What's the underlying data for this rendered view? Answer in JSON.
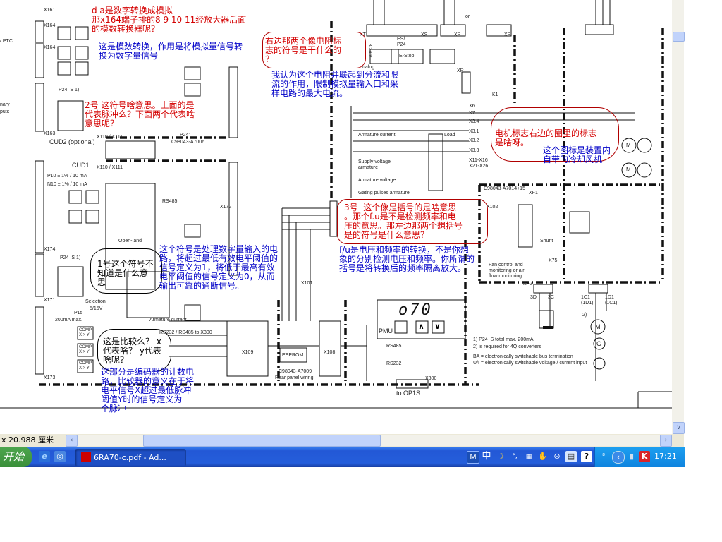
{
  "annotations": {
    "q_da": "d a是数字转换成模拟\n那x164端子排的8 9 10 11经放大器后面\n的模数转换器呢？",
    "a_ad": "这是模数转换，作用是将模拟量信号转\n换为数字量信号",
    "q2": "2号 这符号啥意思。上面的是\n代表脉冲么？下面两个代表啥\n意思呢？",
    "q_resistor": "右边那两个像电阻标\n志的符号是干什么的\n？",
    "a_resistor": "我认为这个电阻并联起到分流和限\n流的作用，限制模拟量输入口和采\n样电路的最大电流。",
    "q3": "3号  这个像是括号的是啥意思\n。那个f.u是不是检测频率和电\n压的意思。那左边那两个想括号\n是的符号是什么意思？",
    "a3": "f/u是电压和频率的转换，不是你想\n象的分别检测电压和频率。你所谓的\n括号是将转换后的频率隔离放大。",
    "q_motor": "电机标志右边的圈里的标志\n是啥呀。",
    "a_motor": "这个图标是装置内\n自带的冷却风机",
    "q1": "1号这个符号不\n知道是什么意\n思",
    "a1": "这个符号是处理数字量输入的电\n路，将超过最低有效电平阈值的\n信号定义为1，将低于最高有效\n电平阈值的信号定义为0，从而\n输出可靠的通断信号。",
    "q_comp": "这是比较么？ x\n代表啥？ y代表\n啥呢？",
    "a_comp": "这部分是编码器的计数电\n路，比较器的意义在于将\n电平信号X超过最低脉冲\n阈值Y时的信号定义为一\n个脉冲"
  },
  "schematic": {
    "x161": "X161",
    "x164a": "X164",
    "x164b": "X164",
    "x163": "X163",
    "ptc": "/ PTC",
    "p24s": "P24_S 1)",
    "binary": "nary",
    "inputs": "puts",
    "cud2": "CUD2 (optional)",
    "x110a": "X110 / X111",
    "x110b": "X110 / X111",
    "cud1": "CUD1",
    "p10": "P10  ± 1% / 10 mA",
    "n10": "N10  ± 1% / 10 mA",
    "c98043_7006": "C98043-A7006",
    "p24p": "P24'",
    "rs485a": "RS485",
    "x172": "X172",
    "x174": "X174",
    "x171": "X171",
    "x173": "X173",
    "openand": "Open- and",
    "selection": "Selection",
    "v515": "5/15V",
    "p15": "P15",
    "ma200": "200mA max.",
    "armcur": "Armature current",
    "rs232": "RS232 / RS485 to X300",
    "x109": "X109",
    "x108": "X108",
    "x101": "X101",
    "eeprom": "EEPROM",
    "c98043_7009": "C98043-A7009",
    "rearpanel": "Rear panel wiring",
    "pmu": "PMU",
    "display": "o70",
    "rs485b": "RS485",
    "rs232b": "RS232",
    "x300": "X300",
    "toop1s": "to  OP1S",
    "estop": "E-Stop",
    "es": "ES/ P24",
    "xs": "XS",
    "xp": "XP",
    "xt": "XT",
    "xr": "XR",
    "k1": "K1",
    "v270": "8-270V",
    "analog": "nalog",
    "x6": "X6",
    "x7": "X7",
    "x34": "X3.4",
    "x31": "X3.1",
    "x32": "X3.2",
    "x33": "X3.3",
    "load": "Load",
    "armcur2": "Armature current",
    "supply": "Supply voltage armature",
    "armvolt": "Armature voltage",
    "gating": "Gating pulses armature",
    "x1116": "X11-X16 X21-X26",
    "c98043_7014": "C98043-A7014+15",
    "xf1": "XF1",
    "xf2": "XF2",
    "x102": "X102",
    "x75": "X75",
    "shunt": "Shunt",
    "fan": "Fan control and monitoring or air flow monitoring",
    "t3d": "3D",
    "t3c": "3C",
    "t1c1": "1C1 (1D1)",
    "t1d1": "1D1 (1C1)",
    "n2": "2)",
    "m": "M",
    "g": "G",
    "fn1": "1) P24_S total max. 200mA",
    "fn2": "2) is required for 4Q converters",
    "fn3": "BA = electronically switchable bus termination",
    "fn4": "U/I = electronically switchable voltage / current input",
    "or": "or",
    "x161b": "X161",
    "comp": "COMP X > Y"
  },
  "statusbar": {
    "pagesize": "x 20.988 厘米"
  },
  "taskbar": {
    "start": "开始",
    "task": "6RA70-c.pdf - Ad...",
    "time": "17:21",
    "ime": "中"
  }
}
